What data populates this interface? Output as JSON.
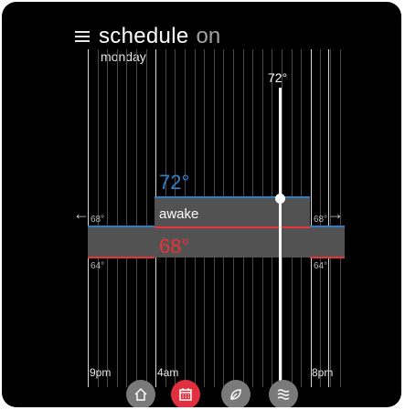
{
  "header": {
    "title": "schedule",
    "state": "on"
  },
  "day": "monday",
  "current": {
    "temp": "72°",
    "setpoint_high": "72°",
    "setpoint_low": "68°",
    "mode": "awake"
  },
  "labels": {
    "left_high": "68°",
    "left_low": "64°",
    "right_high": "68°",
    "right_low": "64°"
  },
  "times": [
    "9pm",
    "4am",
    "8pm"
  ],
  "nav": [
    {
      "icon": "home-icon"
    },
    {
      "icon": "calendar-icon",
      "active": true
    },
    {
      "icon": "leaf-icon"
    },
    {
      "icon": "fan-icon"
    }
  ],
  "colors": {
    "heat": "#e8323c",
    "cool": "#2f80c8",
    "active_nav": "#e03040"
  }
}
